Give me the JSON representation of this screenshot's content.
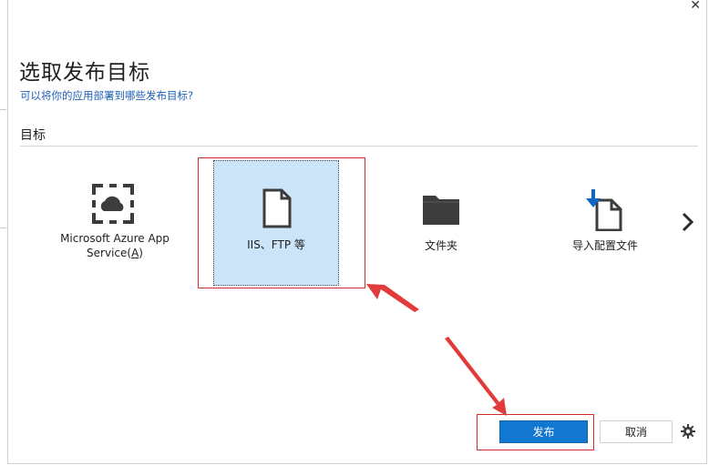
{
  "dialog": {
    "title": "选取发布目标",
    "subtitle": "可以将你的应用部署到哪些发布目标?",
    "section_label": "目标"
  },
  "targets": [
    {
      "label_line1": "Microsoft Azure App",
      "label_line2_prefix": "Service(",
      "label_line2_key": "A",
      "label_line2_suffix": ")",
      "icon": "azure-cloud-icon"
    },
    {
      "label": "IIS、FTP 等",
      "icon": "document-icon",
      "selected": true
    },
    {
      "label": "文件夹",
      "icon": "folder-icon"
    },
    {
      "label": "导入配置文件",
      "icon": "import-profile-icon"
    }
  ],
  "buttons": {
    "publish": "发布",
    "cancel": "取消"
  },
  "colors": {
    "accent": "#1177d1",
    "selected_tile": "#cce4f7",
    "annotation_red": "#d12b2b",
    "link": "#1e5fb4"
  }
}
